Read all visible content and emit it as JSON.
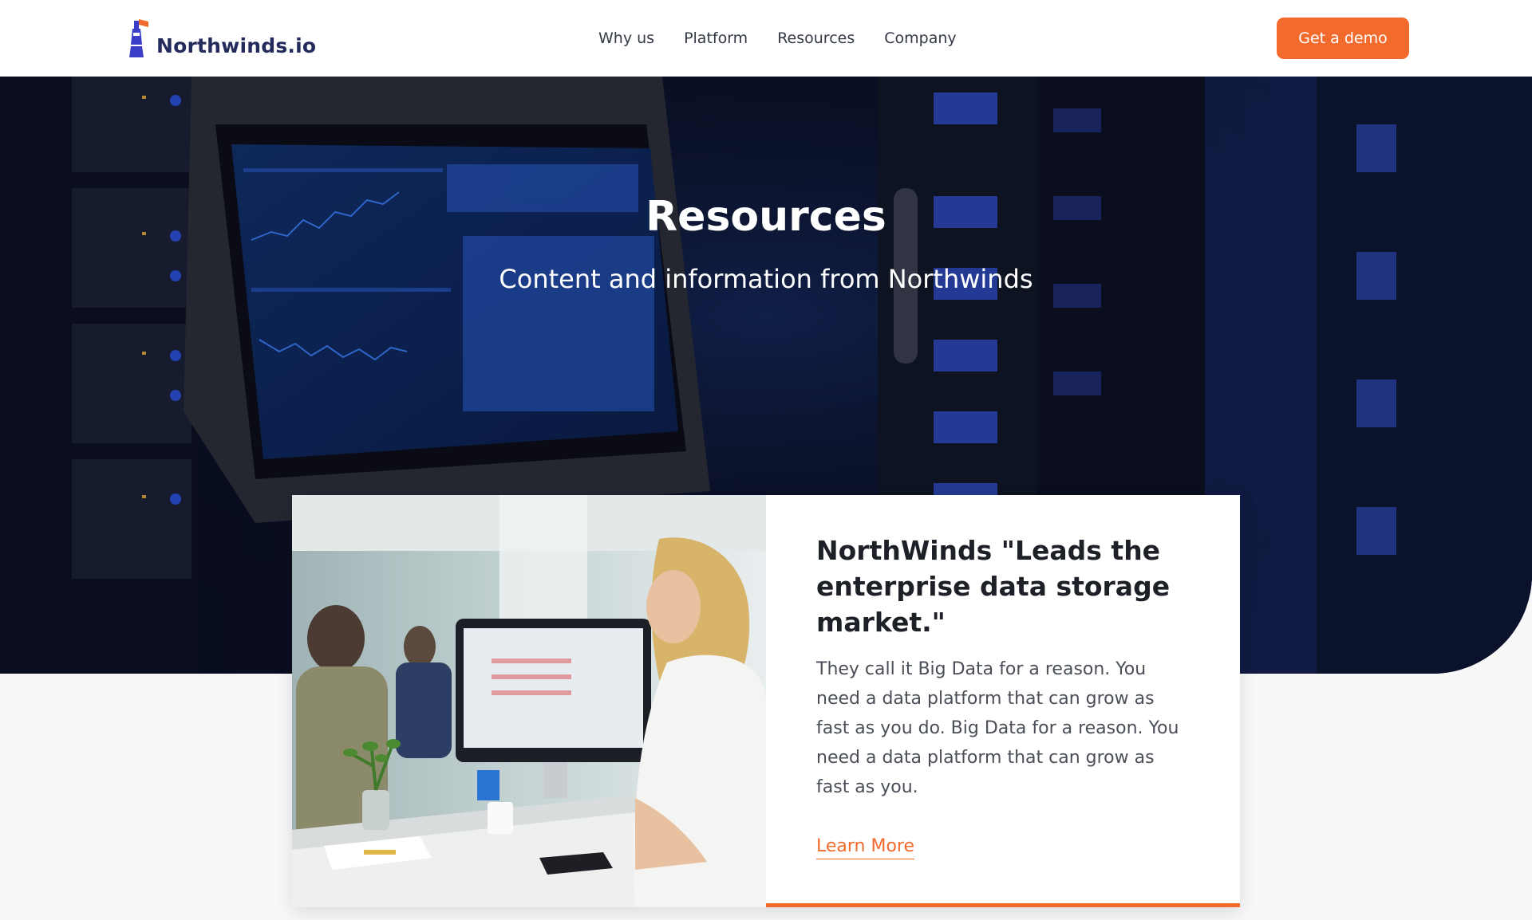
{
  "header": {
    "logo_text": "Northwinds.io",
    "logo_icon": "lighthouse-icon",
    "nav": [
      {
        "label": "Why us"
      },
      {
        "label": "Platform"
      },
      {
        "label": "Resources"
      },
      {
        "label": "Company"
      }
    ],
    "cta_label": "Get a demo"
  },
  "hero": {
    "title": "Resources",
    "subtitle": "Content and information from Northwinds",
    "background_description": "server-room-photo"
  },
  "card": {
    "title": "NorthWinds \"Leads the enterprise data storage market.\"",
    "body": "They call it Big Data for a reason. You need a data platform that can grow as fast as you do. Big Data for a reason. You need a data platform that can grow as fast as you.",
    "link_label": "Learn More"
  },
  "colors": {
    "accent": "#f26b2d",
    "brand": "#3b3ec9",
    "logo_text": "#232a5c",
    "hero_dark": "#060a18"
  }
}
